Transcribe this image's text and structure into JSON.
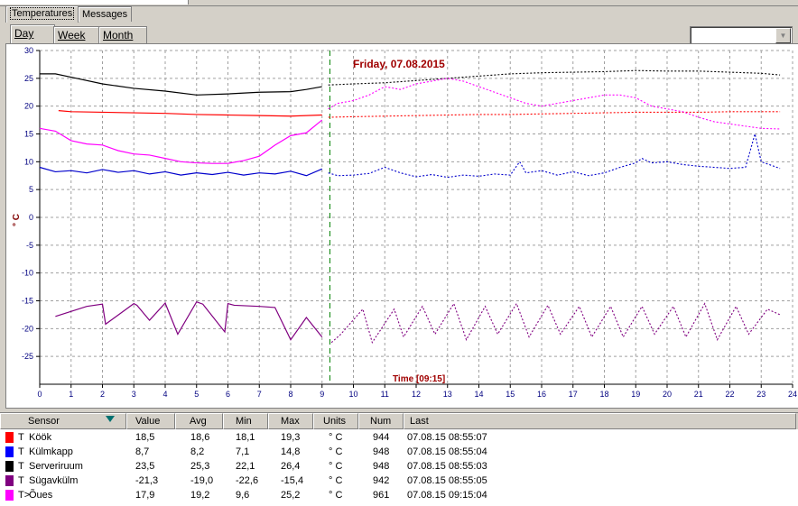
{
  "tabs": [
    {
      "label": "Temperatures",
      "active": true
    },
    {
      "label": "Messages",
      "active": false
    }
  ],
  "range_tabs": [
    {
      "label": "Day",
      "active": true
    },
    {
      "label": "Week",
      "active": false
    },
    {
      "label": "Month",
      "active": false
    }
  ],
  "range_select": {
    "value": ""
  },
  "chart_data": {
    "type": "line",
    "title": "Friday, 07.08.2015",
    "ylabel": "° C",
    "time_marker_label": "Time [09:15]",
    "time_marker": 9.25,
    "xlim": [
      0,
      24
    ],
    "ylim": [
      -30,
      30
    ],
    "x_ticks": [
      "0",
      "1",
      "2",
      "3",
      "4",
      "5",
      "6",
      "7",
      "8",
      "9",
      "10",
      "11",
      "12",
      "13",
      "14",
      "15",
      "16",
      "17",
      "18",
      "19",
      "20",
      "21",
      "22",
      "23",
      "24"
    ],
    "y_ticks": [
      "30",
      "25",
      "20",
      "15",
      "10",
      "5",
      "0",
      "-5",
      "-10",
      "-15",
      "-20",
      "-25"
    ],
    "grid": true,
    "series": [
      {
        "name": "Köök",
        "color": "#ff0000",
        "x": [
          0.6,
          1,
          2,
          3,
          4,
          5,
          6,
          7,
          8,
          9
        ],
        "y": [
          19.2,
          19.0,
          18.9,
          18.8,
          18.7,
          18.5,
          18.4,
          18.3,
          18.2,
          18.4
        ],
        "forecast_x": [
          9.2,
          10,
          11,
          12,
          13,
          14,
          15,
          16,
          17,
          18,
          19,
          20,
          21,
          22,
          23,
          23.6
        ],
        "forecast_y": [
          18.0,
          18.1,
          18.2,
          18.3,
          18.4,
          18.5,
          18.5,
          18.6,
          18.7,
          18.8,
          18.9,
          18.9,
          18.9,
          19.0,
          19.0,
          19.0
        ]
      },
      {
        "name": "Külmkapp",
        "color": "#0000cc",
        "x": [
          0,
          0.5,
          1,
          1.5,
          2,
          2.5,
          3,
          3.5,
          4,
          4.5,
          5,
          5.5,
          6,
          6.5,
          7,
          7.5,
          8,
          8.5,
          9
        ],
        "y": [
          9,
          8.2,
          8.4,
          8.0,
          8.6,
          8.1,
          8.4,
          7.8,
          8.2,
          7.6,
          8.0,
          7.7,
          8.1,
          7.6,
          8.0,
          7.8,
          8.3,
          7.5,
          8.7
        ],
        "forecast_x": [
          9.2,
          9.5,
          10,
          10.5,
          11,
          11.5,
          12,
          12.5,
          13,
          13.5,
          14,
          14.5,
          15,
          15.3,
          15.5,
          16,
          16.5,
          17,
          17.5,
          18,
          18.5,
          19,
          19.2,
          19.5,
          20,
          20.5,
          21,
          21.5,
          22,
          22.5,
          22.8,
          23,
          23.6
        ],
        "forecast_y": [
          8.0,
          7.5,
          7.6,
          7.9,
          9.0,
          8.0,
          7.3,
          7.7,
          7.2,
          7.6,
          7.4,
          7.8,
          7.6,
          10.0,
          8.0,
          8.4,
          7.6,
          8.2,
          7.5,
          8.0,
          9.0,
          9.8,
          10.6,
          9.8,
          10.0,
          9.5,
          9.2,
          9.0,
          8.8,
          9.0,
          15.0,
          10.0,
          8.8
        ]
      },
      {
        "name": "Serveriruum",
        "color": "#000000",
        "x": [
          0,
          0.5,
          1,
          2,
          3,
          4,
          5,
          6,
          7,
          8,
          8.5,
          9
        ],
        "y": [
          25.8,
          25.8,
          25.2,
          24.0,
          23.2,
          22.7,
          22.0,
          22.2,
          22.5,
          22.6,
          23.0,
          23.5
        ],
        "forecast_x": [
          9.2,
          10,
          11,
          12,
          13,
          14,
          15,
          16,
          17,
          18,
          19,
          20,
          21,
          22,
          23,
          23.6
        ],
        "forecast_y": [
          23.8,
          24.0,
          24.2,
          24.6,
          25.0,
          25.4,
          25.8,
          26.0,
          26.1,
          26.2,
          26.4,
          26.3,
          26.3,
          26.1,
          25.9,
          25.6
        ]
      },
      {
        "name": "Sügavkülm",
        "color": "#800080",
        "x": [
          0.5,
          1.5,
          2,
          2.1,
          3,
          3.1,
          3.5,
          4,
          4.4,
          5,
          5.2,
          5.9,
          6,
          6.2,
          7,
          7.5,
          8,
          8.5,
          9
        ],
        "y": [
          -17.8,
          -16.0,
          -15.6,
          -19.2,
          -15.5,
          -15.8,
          -18.5,
          -15.4,
          -21.0,
          -15.2,
          -15.6,
          -20.6,
          -15.5,
          -15.8,
          -16.0,
          -16.2,
          -22.0,
          -18.0,
          -21.5
        ],
        "forecast_x": [
          9.3,
          9.6,
          10.3,
          10.6,
          11.3,
          11.6,
          12.2,
          12.6,
          13.2,
          13.6,
          14.2,
          14.6,
          15.2,
          15.6,
          16.2,
          16.6,
          17.2,
          17.6,
          18.2,
          18.6,
          19.2,
          19.6,
          20.2,
          20.6,
          21.2,
          21.6,
          22.2,
          22.6,
          23.2,
          23.6
        ],
        "forecast_y": [
          -22.5,
          -21.0,
          -16.5,
          -22.5,
          -16.5,
          -21.5,
          -16.0,
          -21.0,
          -15.5,
          -22.0,
          -16.0,
          -21.0,
          -15.5,
          -21.5,
          -15.8,
          -21.0,
          -16.0,
          -21.5,
          -16.0,
          -21.5,
          -16.0,
          -21.0,
          -16.0,
          -21.5,
          -15.5,
          -22.0,
          -16.0,
          -21.0,
          -16.5,
          -17.5
        ]
      },
      {
        "name": "Õues",
        "color": "#ff00ff",
        "x": [
          0,
          0.5,
          1,
          1.5,
          2,
          2.5,
          3,
          3.5,
          4,
          4.5,
          5,
          5.5,
          6,
          6.5,
          7,
          7.5,
          8,
          8.5,
          9
        ],
        "y": [
          16.0,
          15.5,
          13.8,
          13.2,
          13.0,
          12.0,
          11.4,
          11.2,
          10.6,
          10.0,
          9.8,
          9.7,
          9.7,
          10.2,
          11.0,
          13.0,
          14.7,
          15.2,
          17.5
        ],
        "forecast_x": [
          9.2,
          9.5,
          10,
          10.5,
          11,
          11.5,
          12,
          12.5,
          13,
          13.5,
          14,
          14.5,
          15,
          15.5,
          16,
          16.5,
          17,
          17.5,
          18,
          18.5,
          19,
          19.5,
          20,
          20.5,
          21,
          21.5,
          22,
          22.5,
          23,
          23.6
        ],
        "forecast_y": [
          19.5,
          20.5,
          21.0,
          22.0,
          23.5,
          23.0,
          24.0,
          24.5,
          25.0,
          24.5,
          23.5,
          22.5,
          21.5,
          20.5,
          20.0,
          20.5,
          21.0,
          21.5,
          22.0,
          22.0,
          21.5,
          20.0,
          19.5,
          19.0,
          18.0,
          17.2,
          16.8,
          16.4,
          16.0,
          15.9
        ]
      }
    ]
  },
  "table": {
    "columns": [
      "Sensor",
      "Value",
      "Avg",
      "Min",
      "Max",
      "Units",
      "Num",
      "Last"
    ],
    "rows": [
      {
        "type": "T",
        "sensor": "Köök",
        "value": "18,5",
        "avg": "18,6",
        "min": "18,1",
        "max": "19,3",
        "units": "° C",
        "num": "944",
        "last": "07.08.15 08:55:07",
        "color": "#ff0000"
      },
      {
        "type": "T",
        "sensor": "Külmkapp",
        "value": "8,7",
        "avg": "8,2",
        "min": "7,1",
        "max": "14,8",
        "units": "° C",
        "num": "948",
        "last": "07.08.15 08:55:04",
        "color": "#0000ff"
      },
      {
        "type": "T",
        "sensor": "Serveriruum",
        "value": "23,5",
        "avg": "25,3",
        "min": "22,1",
        "max": "26,4",
        "units": "° C",
        "num": "948",
        "last": "07.08.15 08:55:03",
        "color": "#000000"
      },
      {
        "type": "T",
        "sensor": "Sügavkülm",
        "value": "-21,3",
        "avg": "-19,0",
        "min": "-22,6",
        "max": "-15,4",
        "units": "° C",
        "num": "942",
        "last": "07.08.15 08:55:05",
        "color": "#800080"
      },
      {
        "type": "T>",
        "sensor": "Õues",
        "value": "17,9",
        "avg": "19,2",
        "min": "9,6",
        "max": "25,2",
        "units": "° C",
        "num": "961",
        "last": "07.08.15 09:15:04",
        "color": "#ff00ff"
      }
    ]
  }
}
